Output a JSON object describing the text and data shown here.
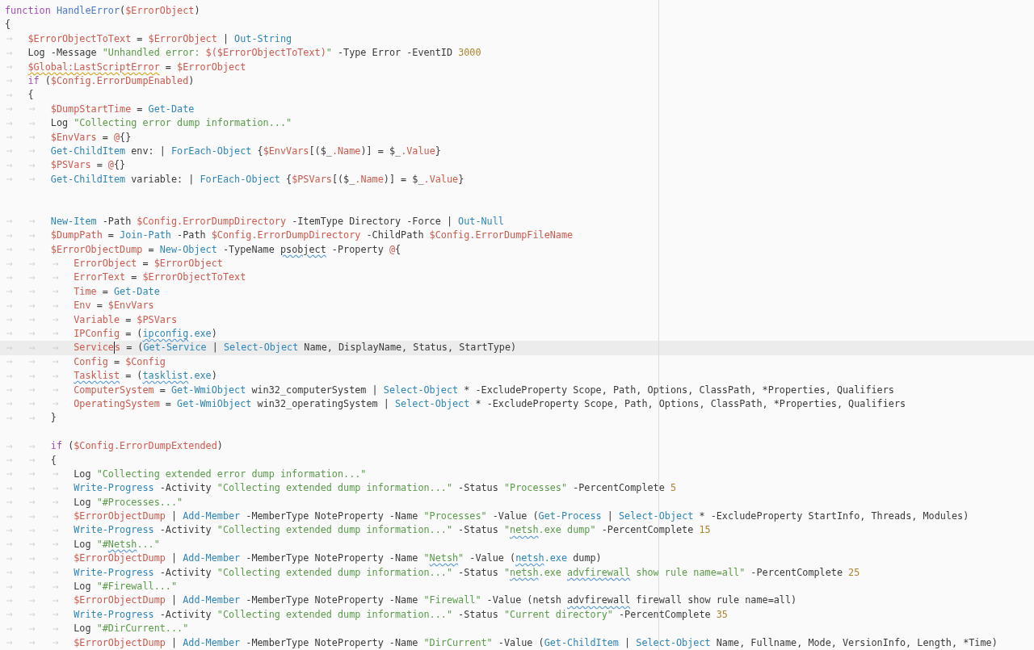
{
  "editor": {
    "lines": [
      {
        "kind": "code",
        "current": false,
        "tokens": [
          {
            "kind": "kw",
            "text": "function "
          },
          {
            "kind": "fn",
            "text": "HandleError"
          },
          {
            "kind": "txt",
            "text": "("
          },
          {
            "kind": "var",
            "text": "$ErrorObject"
          },
          {
            "kind": "txt",
            "text": ")"
          }
        ]
      },
      {
        "kind": "code",
        "current": false,
        "tokens": [
          {
            "kind": "txt",
            "text": "{"
          }
        ]
      },
      {
        "kind": "code",
        "current": false,
        "tokens": [
          {
            "kind": "tab"
          },
          {
            "kind": "var",
            "text": "$ErrorObjectToText"
          },
          {
            "kind": "txt",
            "text": " = "
          },
          {
            "kind": "var",
            "text": "$ErrorObject"
          },
          {
            "kind": "txt",
            "text": " | "
          },
          {
            "kind": "cmd",
            "text": "Out-String"
          }
        ]
      },
      {
        "kind": "code",
        "current": false,
        "tokens": [
          {
            "kind": "tab"
          },
          {
            "kind": "txt",
            "text": "Log -Message "
          },
          {
            "kind": "str",
            "text": "\"Unhandled error: "
          },
          {
            "kind": "var",
            "text": "$($ErrorObjectToText)"
          },
          {
            "kind": "str",
            "text": "\""
          },
          {
            "kind": "txt",
            "text": " -Type Error -EventID "
          },
          {
            "kind": "num",
            "text": "3000"
          }
        ]
      },
      {
        "kind": "code",
        "current": false,
        "tokens": [
          {
            "kind": "tab"
          },
          {
            "kind": "var",
            "text": "$Global:LastScriptError",
            "warning": true
          },
          {
            "kind": "txt",
            "text": " = "
          },
          {
            "kind": "var",
            "text": "$ErrorObject"
          }
        ]
      },
      {
        "kind": "code",
        "current": false,
        "tokens": [
          {
            "kind": "tab"
          },
          {
            "kind": "kw",
            "text": "if "
          },
          {
            "kind": "txt",
            "text": "("
          },
          {
            "kind": "var",
            "text": "$Config.ErrorDumpEnabled"
          },
          {
            "kind": "txt",
            "text": ")"
          }
        ]
      },
      {
        "kind": "code",
        "current": false,
        "tokens": [
          {
            "kind": "tab"
          },
          {
            "kind": "txt",
            "text": "{"
          }
        ]
      },
      {
        "kind": "code",
        "current": false,
        "tokens": [
          {
            "kind": "tab"
          },
          {
            "kind": "tab"
          },
          {
            "kind": "var",
            "text": "$DumpStartTime"
          },
          {
            "kind": "txt",
            "text": " = "
          },
          {
            "kind": "cmd",
            "text": "Get-Date"
          }
        ]
      },
      {
        "kind": "code",
        "current": false,
        "tokens": [
          {
            "kind": "tab"
          },
          {
            "kind": "tab"
          },
          {
            "kind": "txt",
            "text": "Log "
          },
          {
            "kind": "str",
            "text": "\"Collecting error dump information...\""
          }
        ]
      },
      {
        "kind": "code",
        "current": false,
        "tokens": [
          {
            "kind": "tab"
          },
          {
            "kind": "tab"
          },
          {
            "kind": "var",
            "text": "$EnvVars"
          },
          {
            "kind": "txt",
            "text": " = "
          },
          {
            "kind": "var",
            "text": "@"
          },
          {
            "kind": "txt",
            "text": "{}"
          }
        ]
      },
      {
        "kind": "code",
        "current": false,
        "tokens": [
          {
            "kind": "tab"
          },
          {
            "kind": "tab"
          },
          {
            "kind": "cmd",
            "text": "Get-ChildItem"
          },
          {
            "kind": "txt",
            "text": " env: | "
          },
          {
            "kind": "cmd",
            "text": "ForEach-Object"
          },
          {
            "kind": "txt",
            "text": " {"
          },
          {
            "kind": "var",
            "text": "$EnvVars"
          },
          {
            "kind": "txt",
            "text": "[($_"
          },
          {
            "kind": "var",
            "text": ".Name"
          },
          {
            "kind": "txt",
            "text": ")] = $_"
          },
          {
            "kind": "var",
            "text": ".Value"
          },
          {
            "kind": "txt",
            "text": "}"
          }
        ]
      },
      {
        "kind": "code",
        "current": false,
        "tokens": [
          {
            "kind": "tab"
          },
          {
            "kind": "tab"
          },
          {
            "kind": "var",
            "text": "$PSVars"
          },
          {
            "kind": "txt",
            "text": " = "
          },
          {
            "kind": "var",
            "text": "@"
          },
          {
            "kind": "txt",
            "text": "{}"
          }
        ]
      },
      {
        "kind": "code",
        "current": false,
        "tokens": [
          {
            "kind": "tab"
          },
          {
            "kind": "tab"
          },
          {
            "kind": "cmd",
            "text": "Get-ChildItem"
          },
          {
            "kind": "txt",
            "text": " variable: | "
          },
          {
            "kind": "cmd",
            "text": "ForEach-Object"
          },
          {
            "kind": "txt",
            "text": " {"
          },
          {
            "kind": "var",
            "text": "$PSVars"
          },
          {
            "kind": "txt",
            "text": "[($_"
          },
          {
            "kind": "var",
            "text": ".Name"
          },
          {
            "kind": "txt",
            "text": ")] = $_"
          },
          {
            "kind": "var",
            "text": ".Value"
          },
          {
            "kind": "txt",
            "text": "}"
          }
        ]
      },
      {
        "kind": "blank"
      },
      {
        "kind": "blank"
      },
      {
        "kind": "code",
        "current": false,
        "tokens": [
          {
            "kind": "tab"
          },
          {
            "kind": "tab"
          },
          {
            "kind": "cmd",
            "text": "New-Item"
          },
          {
            "kind": "txt",
            "text": " -Path "
          },
          {
            "kind": "var",
            "text": "$Config.ErrorDumpDirectory"
          },
          {
            "kind": "txt",
            "text": " -ItemType Directory -Force | "
          },
          {
            "kind": "cmd",
            "text": "Out-Null"
          }
        ]
      },
      {
        "kind": "code",
        "current": false,
        "tokens": [
          {
            "kind": "tab"
          },
          {
            "kind": "tab"
          },
          {
            "kind": "var",
            "text": "$DumpPath"
          },
          {
            "kind": "txt",
            "text": " = "
          },
          {
            "kind": "cmd",
            "text": "Join-Path"
          },
          {
            "kind": "txt",
            "text": " -Path "
          },
          {
            "kind": "var",
            "text": "$Config.ErrorDumpDirectory"
          },
          {
            "kind": "txt",
            "text": " -ChildPath "
          },
          {
            "kind": "var",
            "text": "$Config.ErrorDumpFileName"
          }
        ]
      },
      {
        "kind": "code",
        "current": false,
        "tokens": [
          {
            "kind": "tab"
          },
          {
            "kind": "tab"
          },
          {
            "kind": "var",
            "text": "$ErrorObjectDump"
          },
          {
            "kind": "txt",
            "text": " = "
          },
          {
            "kind": "cmd",
            "text": "New-Object"
          },
          {
            "kind": "txt",
            "text": " -TypeName "
          },
          {
            "kind": "txt",
            "text": "psobject",
            "misspelled": true
          },
          {
            "kind": "txt",
            "text": " -Property "
          },
          {
            "kind": "var",
            "text": "@"
          },
          {
            "kind": "txt",
            "text": "{"
          }
        ]
      },
      {
        "kind": "code",
        "current": false,
        "tokens": [
          {
            "kind": "tab"
          },
          {
            "kind": "tab"
          },
          {
            "kind": "tab"
          },
          {
            "kind": "var",
            "text": "ErrorObject"
          },
          {
            "kind": "txt",
            "text": " = "
          },
          {
            "kind": "var",
            "text": "$ErrorObject"
          }
        ]
      },
      {
        "kind": "code",
        "current": false,
        "tokens": [
          {
            "kind": "tab"
          },
          {
            "kind": "tab"
          },
          {
            "kind": "tab"
          },
          {
            "kind": "var",
            "text": "ErrorText"
          },
          {
            "kind": "txt",
            "text": " = "
          },
          {
            "kind": "var",
            "text": "$ErrorObjectToText"
          }
        ]
      },
      {
        "kind": "code",
        "current": false,
        "tokens": [
          {
            "kind": "tab"
          },
          {
            "kind": "tab"
          },
          {
            "kind": "tab"
          },
          {
            "kind": "var",
            "text": "Time"
          },
          {
            "kind": "txt",
            "text": " = "
          },
          {
            "kind": "cmd",
            "text": "Get-Date"
          }
        ]
      },
      {
        "kind": "code",
        "current": false,
        "tokens": [
          {
            "kind": "tab"
          },
          {
            "kind": "tab"
          },
          {
            "kind": "tab"
          },
          {
            "kind": "var",
            "text": "Env"
          },
          {
            "kind": "txt",
            "text": " = "
          },
          {
            "kind": "var",
            "text": "$EnvVars"
          }
        ]
      },
      {
        "kind": "code",
        "current": false,
        "tokens": [
          {
            "kind": "tab"
          },
          {
            "kind": "tab"
          },
          {
            "kind": "tab"
          },
          {
            "kind": "var",
            "text": "Variable"
          },
          {
            "kind": "txt",
            "text": " = "
          },
          {
            "kind": "var",
            "text": "$PSVars"
          }
        ]
      },
      {
        "kind": "code",
        "current": false,
        "tokens": [
          {
            "kind": "tab"
          },
          {
            "kind": "tab"
          },
          {
            "kind": "tab"
          },
          {
            "kind": "var",
            "text": "IPConfig"
          },
          {
            "kind": "txt",
            "text": " = ("
          },
          {
            "kind": "cmd",
            "text": "ipconfig",
            "misspelled": true
          },
          {
            "kind": "cmd",
            "text": ".exe"
          },
          {
            "kind": "txt",
            "text": ")"
          }
        ]
      },
      {
        "kind": "code",
        "current": true,
        "tokens": [
          {
            "kind": "tab"
          },
          {
            "kind": "tab"
          },
          {
            "kind": "tab"
          },
          {
            "kind": "var",
            "text": "Service",
            "caret": true
          },
          {
            "kind": "var",
            "text": "s"
          },
          {
            "kind": "txt",
            "text": " = ("
          },
          {
            "kind": "cmd",
            "text": "Get-Service"
          },
          {
            "kind": "txt",
            "text": " | "
          },
          {
            "kind": "cmd",
            "text": "Select-Object"
          },
          {
            "kind": "txt",
            "text": " Name, DisplayName, Status, StartType)"
          }
        ]
      },
      {
        "kind": "code",
        "current": false,
        "tokens": [
          {
            "kind": "tab"
          },
          {
            "kind": "tab"
          },
          {
            "kind": "tab"
          },
          {
            "kind": "var",
            "text": "Config"
          },
          {
            "kind": "txt",
            "text": " = "
          },
          {
            "kind": "var",
            "text": "$Config"
          }
        ]
      },
      {
        "kind": "code",
        "current": false,
        "tokens": [
          {
            "kind": "tab"
          },
          {
            "kind": "tab"
          },
          {
            "kind": "tab"
          },
          {
            "kind": "var",
            "text": "Tasklist",
            "misspelled": true
          },
          {
            "kind": "txt",
            "text": " = ("
          },
          {
            "kind": "cmd",
            "text": "tasklist",
            "misspelled": true
          },
          {
            "kind": "cmd",
            "text": ".exe"
          },
          {
            "kind": "txt",
            "text": ")"
          }
        ]
      },
      {
        "kind": "code",
        "current": false,
        "tokens": [
          {
            "kind": "tab"
          },
          {
            "kind": "tab"
          },
          {
            "kind": "tab"
          },
          {
            "kind": "var",
            "text": "ComputerSystem"
          },
          {
            "kind": "txt",
            "text": " = "
          },
          {
            "kind": "cmd",
            "text": "Get-WmiObject"
          },
          {
            "kind": "txt",
            "text": " win32_computerSystem | "
          },
          {
            "kind": "cmd",
            "text": "Select-Object"
          },
          {
            "kind": "txt",
            "text": " * -ExcludeProperty Scope, Path, Options, ClassPath, *Properties, Qualifiers"
          }
        ]
      },
      {
        "kind": "code",
        "current": false,
        "tokens": [
          {
            "kind": "tab"
          },
          {
            "kind": "tab"
          },
          {
            "kind": "tab"
          },
          {
            "kind": "var",
            "text": "OperatingSystem"
          },
          {
            "kind": "txt",
            "text": " = "
          },
          {
            "kind": "cmd",
            "text": "Get-WmiObject"
          },
          {
            "kind": "txt",
            "text": " win32_operatingSystem | "
          },
          {
            "kind": "cmd",
            "text": "Select-Object"
          },
          {
            "kind": "txt",
            "text": " * -ExcludeProperty Scope, Path, Options, ClassPath, *Properties, Qualifiers"
          }
        ]
      },
      {
        "kind": "code",
        "current": false,
        "tokens": [
          {
            "kind": "tab"
          },
          {
            "kind": "tab"
          },
          {
            "kind": "txt",
            "text": "}"
          }
        ]
      },
      {
        "kind": "blank"
      },
      {
        "kind": "code",
        "current": false,
        "tokens": [
          {
            "kind": "tab"
          },
          {
            "kind": "tab"
          },
          {
            "kind": "kw",
            "text": "if "
          },
          {
            "kind": "txt",
            "text": "("
          },
          {
            "kind": "var",
            "text": "$Config.ErrorDumpExtended"
          },
          {
            "kind": "txt",
            "text": ")"
          }
        ]
      },
      {
        "kind": "code",
        "current": false,
        "tokens": [
          {
            "kind": "tab"
          },
          {
            "kind": "tab"
          },
          {
            "kind": "txt",
            "text": "{"
          }
        ]
      },
      {
        "kind": "code",
        "current": false,
        "tokens": [
          {
            "kind": "tab"
          },
          {
            "kind": "tab"
          },
          {
            "kind": "tab"
          },
          {
            "kind": "txt",
            "text": "Log "
          },
          {
            "kind": "str",
            "text": "\"Collecting extended error dump information...\""
          }
        ]
      },
      {
        "kind": "code",
        "current": false,
        "tokens": [
          {
            "kind": "tab"
          },
          {
            "kind": "tab"
          },
          {
            "kind": "tab"
          },
          {
            "kind": "cmd",
            "text": "Write-Progress"
          },
          {
            "kind": "txt",
            "text": " -Activity "
          },
          {
            "kind": "str",
            "text": "\"Collecting extended dump information...\""
          },
          {
            "kind": "txt",
            "text": " -Status "
          },
          {
            "kind": "str",
            "text": "\"Processes\""
          },
          {
            "kind": "txt",
            "text": " -PercentComplete "
          },
          {
            "kind": "num",
            "text": "5"
          }
        ]
      },
      {
        "kind": "code",
        "current": false,
        "tokens": [
          {
            "kind": "tab"
          },
          {
            "kind": "tab"
          },
          {
            "kind": "tab"
          },
          {
            "kind": "txt",
            "text": "Log "
          },
          {
            "kind": "str",
            "text": "\"#Processes...\""
          }
        ]
      },
      {
        "kind": "code",
        "current": false,
        "tokens": [
          {
            "kind": "tab"
          },
          {
            "kind": "tab"
          },
          {
            "kind": "tab"
          },
          {
            "kind": "var",
            "text": "$ErrorObjectDump"
          },
          {
            "kind": "txt",
            "text": " | "
          },
          {
            "kind": "cmd",
            "text": "Add-Member"
          },
          {
            "kind": "txt",
            "text": " -MemberType NoteProperty -Name "
          },
          {
            "kind": "str",
            "text": "\"Processes\""
          },
          {
            "kind": "txt",
            "text": " -Value ("
          },
          {
            "kind": "cmd",
            "text": "Get-Process"
          },
          {
            "kind": "txt",
            "text": " | "
          },
          {
            "kind": "cmd",
            "text": "Select-Object"
          },
          {
            "kind": "txt",
            "text": " * -ExcludeProperty StartInfo, Threads, Modules)"
          }
        ]
      },
      {
        "kind": "code",
        "current": false,
        "tokens": [
          {
            "kind": "tab"
          },
          {
            "kind": "tab"
          },
          {
            "kind": "tab"
          },
          {
            "kind": "cmd",
            "text": "Write-Progress"
          },
          {
            "kind": "txt",
            "text": " -Activity "
          },
          {
            "kind": "str",
            "text": "\"Collecting extended dump information...\""
          },
          {
            "kind": "txt",
            "text": " -Status "
          },
          {
            "kind": "str",
            "text": "\""
          },
          {
            "kind": "str",
            "text": "netsh",
            "misspelled": true
          },
          {
            "kind": "str",
            "text": ".exe dump\""
          },
          {
            "kind": "txt",
            "text": " -PercentComplete "
          },
          {
            "kind": "num",
            "text": "15"
          }
        ]
      },
      {
        "kind": "code",
        "current": false,
        "tokens": [
          {
            "kind": "tab"
          },
          {
            "kind": "tab"
          },
          {
            "kind": "tab"
          },
          {
            "kind": "txt",
            "text": "Log "
          },
          {
            "kind": "str",
            "text": "\"#"
          },
          {
            "kind": "str",
            "text": "Netsh",
            "misspelled": true
          },
          {
            "kind": "str",
            "text": "...\""
          }
        ]
      },
      {
        "kind": "code",
        "current": false,
        "tokens": [
          {
            "kind": "tab"
          },
          {
            "kind": "tab"
          },
          {
            "kind": "tab"
          },
          {
            "kind": "var",
            "text": "$ErrorObjectDump"
          },
          {
            "kind": "txt",
            "text": " | "
          },
          {
            "kind": "cmd",
            "text": "Add-Member"
          },
          {
            "kind": "txt",
            "text": " -MemberType NoteProperty -Name "
          },
          {
            "kind": "str",
            "text": "\""
          },
          {
            "kind": "str",
            "text": "Netsh",
            "misspelled": true
          },
          {
            "kind": "str",
            "text": "\""
          },
          {
            "kind": "txt",
            "text": " -Value ("
          },
          {
            "kind": "cmd",
            "text": "netsh",
            "misspelled": true
          },
          {
            "kind": "cmd",
            "text": ".exe"
          },
          {
            "kind": "txt",
            "text": " dump)"
          }
        ]
      },
      {
        "kind": "code",
        "current": false,
        "tokens": [
          {
            "kind": "tab"
          },
          {
            "kind": "tab"
          },
          {
            "kind": "tab"
          },
          {
            "kind": "cmd",
            "text": "Write-Progress"
          },
          {
            "kind": "txt",
            "text": " -Activity "
          },
          {
            "kind": "str",
            "text": "\"Collecting extended dump information...\""
          },
          {
            "kind": "txt",
            "text": " -Status "
          },
          {
            "kind": "str",
            "text": "\""
          },
          {
            "kind": "str",
            "text": "netsh",
            "misspelled": true
          },
          {
            "kind": "str",
            "text": ".exe "
          },
          {
            "kind": "str",
            "text": "advfirewall",
            "misspelled": true
          },
          {
            "kind": "str",
            "text": " show rule name=all\""
          },
          {
            "kind": "txt",
            "text": " -PercentComplete "
          },
          {
            "kind": "num",
            "text": "25"
          }
        ]
      },
      {
        "kind": "code",
        "current": false,
        "tokens": [
          {
            "kind": "tab"
          },
          {
            "kind": "tab"
          },
          {
            "kind": "tab"
          },
          {
            "kind": "txt",
            "text": "Log "
          },
          {
            "kind": "str",
            "text": "\"#Firewall...\""
          }
        ]
      },
      {
        "kind": "code",
        "current": false,
        "tokens": [
          {
            "kind": "tab"
          },
          {
            "kind": "tab"
          },
          {
            "kind": "tab"
          },
          {
            "kind": "var",
            "text": "$ErrorObjectDump"
          },
          {
            "kind": "txt",
            "text": " | "
          },
          {
            "kind": "cmd",
            "text": "Add-Member"
          },
          {
            "kind": "txt",
            "text": " -MemberType NoteProperty -Name "
          },
          {
            "kind": "str",
            "text": "\"Firewall\""
          },
          {
            "kind": "txt",
            "text": " -Value (netsh "
          },
          {
            "kind": "txt",
            "text": "advfirewall",
            "misspelled": true
          },
          {
            "kind": "txt",
            "text": " firewall show rule name=all)"
          }
        ]
      },
      {
        "kind": "code",
        "current": false,
        "tokens": [
          {
            "kind": "tab"
          },
          {
            "kind": "tab"
          },
          {
            "kind": "tab"
          },
          {
            "kind": "cmd",
            "text": "Write-Progress"
          },
          {
            "kind": "txt",
            "text": " -Activity "
          },
          {
            "kind": "str",
            "text": "\"Collecting extended dump information...\""
          },
          {
            "kind": "txt",
            "text": " -Status "
          },
          {
            "kind": "str",
            "text": "\"Current directory\""
          },
          {
            "kind": "txt",
            "text": " -PercentComplete "
          },
          {
            "kind": "num",
            "text": "35"
          }
        ]
      },
      {
        "kind": "code",
        "current": false,
        "tokens": [
          {
            "kind": "tab"
          },
          {
            "kind": "tab"
          },
          {
            "kind": "tab"
          },
          {
            "kind": "txt",
            "text": "Log "
          },
          {
            "kind": "str",
            "text": "\"#DirCurrent...\""
          }
        ]
      },
      {
        "kind": "code",
        "current": false,
        "tokens": [
          {
            "kind": "tab"
          },
          {
            "kind": "tab"
          },
          {
            "kind": "tab"
          },
          {
            "kind": "var",
            "text": "$ErrorObjectDump"
          },
          {
            "kind": "txt",
            "text": " | "
          },
          {
            "kind": "cmd",
            "text": "Add-Member"
          },
          {
            "kind": "txt",
            "text": " -MemberType NoteProperty -Name "
          },
          {
            "kind": "str",
            "text": "\"DirCurrent\""
          },
          {
            "kind": "txt",
            "text": " -Value ("
          },
          {
            "kind": "cmd",
            "text": "Get-ChildItem"
          },
          {
            "kind": "txt",
            "text": " | "
          },
          {
            "kind": "cmd",
            "text": "Select-Object"
          },
          {
            "kind": "txt",
            "text": " Name, Fullname, Mode, VersionInfo, Length, *Time)"
          }
        ]
      }
    ]
  }
}
